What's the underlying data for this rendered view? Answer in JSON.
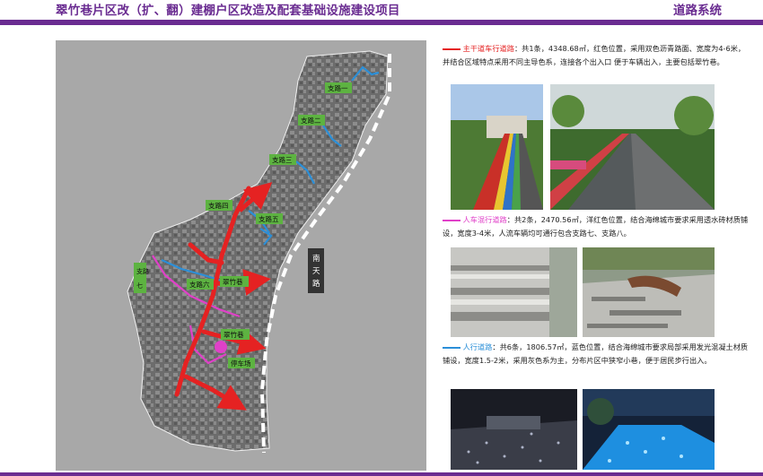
{
  "header": {
    "title_part1": "翠竹巷片区",
    "title_part2": "改（扩、翻）建棚户区改造及配套基础设施建设项目",
    "section": "道路系统"
  },
  "colors": {
    "brand": "#6a2c91",
    "main_road": "#e52222",
    "mixed_road": "#e040c8",
    "pedestrian_road": "#2b8fd8"
  },
  "map": {
    "labels": {
      "branch1": "支路一",
      "branch2": "支路二",
      "branch3": "支路三",
      "branch4": "支路四",
      "branch5": "支路五",
      "branch6": "支路六",
      "branch7": "支路七",
      "street_cuizhu1": "翠竹巷",
      "street_cuizhu2": "翠竹巷",
      "street_cuizhu3": "翠竹巷",
      "street_cuizhu4": "翠竹巷",
      "parking": "停车场",
      "nantian": "南天路"
    }
  },
  "legend": {
    "main": {
      "name": "主干道车行道路",
      "text": "：共1条，4348.68㎡，红色位置，采用双色沥青路面、宽度为4-6米，并结合区域特点采用不同主导色系，连接各个出入口 便于车辆出入，主要包括翠竹巷。"
    },
    "mixed": {
      "name": "人车混行道路",
      "text": "：共2条，2470.56㎡，洋红色位置，结合海绵城市要求采用透水砖材质铺设，宽度3-4米，人流车辆均可通行包含支路七、支路八。"
    },
    "pedestrian": {
      "name": "人行道路",
      "text": "：共6条，1806.57㎡，蓝色位置，结合海绵城市要求局部采用发光混凝土材质铺设，宽度1.5-2米，采用灰色系为主，分布片区中狭窄小巷，便于居民步行出入。"
    }
  },
  "photos": [
    {
      "icon": "colored-asphalt-road-photo"
    },
    {
      "icon": "red-asphalt-greenway-photo"
    },
    {
      "icon": "permeable-brick-paving-photo"
    },
    {
      "icon": "paved-plaza-bench-photo"
    },
    {
      "icon": "glowing-pavement-night-photo"
    },
    {
      "icon": "glowing-blue-path-photo"
    }
  ]
}
